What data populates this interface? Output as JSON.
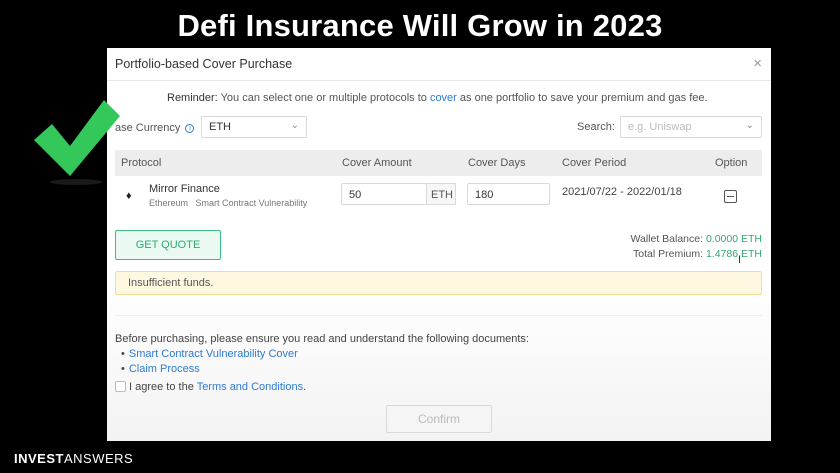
{
  "headline": "Defi Insurance Will Grow in 2023",
  "modal": {
    "title": "Portfolio-based Cover Purchase",
    "close_icon": "×",
    "reminder": {
      "label": "Reminder:",
      "text_before": " You can select one or multiple protocols to ",
      "link": "cover",
      "text_after": " as one portfolio to save your premium and gas fee."
    },
    "currency": {
      "label": "ase Currency",
      "info_icon": "i",
      "value": "ETH",
      "chevron": "⌄"
    },
    "search": {
      "label": "Search:",
      "placeholder": "e.g. Uniswap",
      "chevron": "⌄"
    },
    "table": {
      "headers": {
        "protocol": "Protocol",
        "amount": "Cover Amount",
        "days": "Cover Days",
        "period": "Cover Period",
        "option": "Option"
      },
      "rows": [
        {
          "icon": "♦",
          "name": "Mirror Finance",
          "chain": "Ethereum",
          "type": "Smart Contract Vulnerability",
          "amount": "50",
          "unit": "ETH",
          "days": "180",
          "period": "2021/07/22 - 2022/01/18"
        }
      ]
    },
    "quote_button": "GET QUOTE",
    "wallet_balance_label": "Wallet Balance: ",
    "wallet_balance_value": "0.0000 ETH",
    "total_premium_label": "Total Premium: ",
    "total_premium_value": "1.4786 ETH",
    "warning": "Insufficient funds.",
    "docs_intro": "Before purchasing, please ensure you read and understand the following documents:",
    "docs": [
      "Smart Contract Vulnerability Cover",
      "Claim Process"
    ],
    "bullet": "•",
    "agree_text": "I agree to the ",
    "agree_link": "Terms and Conditions",
    "agree_end": ".",
    "confirm_button": "Confirm"
  },
  "brand": {
    "part1": "INVEST",
    "part2": "ANSWERS"
  },
  "colors": {
    "accent_green": "#2fa96f",
    "link_blue": "#2e7bcf",
    "checkmark_green": "#34c759"
  }
}
